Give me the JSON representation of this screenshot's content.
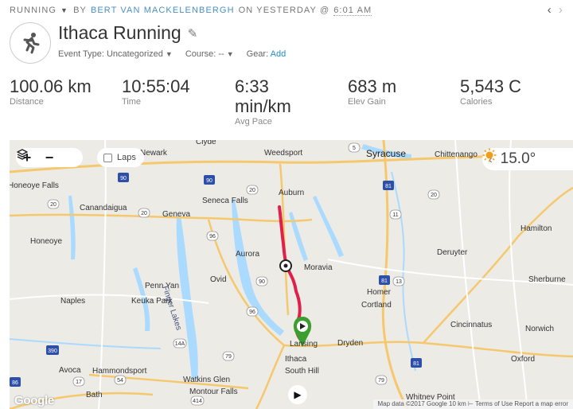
{
  "topbar": {
    "activity_type": "RUNNING",
    "by": "BY",
    "owner": "BERT VAN MACKELENBERGH",
    "when": "ON YESTERDAY @",
    "time": "6:01 AM",
    "prev_icon": "chevron-left-icon",
    "next_icon": "chevron-right-icon"
  },
  "header": {
    "activity_icon": "running-person-icon",
    "title": "Ithaca Running",
    "edit_icon": "pencil-icon",
    "event_type": "Event Type: Uncategorized",
    "course": "Course: --",
    "gear_label": "Gear:",
    "gear_add": "Add"
  },
  "stats": [
    {
      "value": "100.06 km",
      "label": "Distance"
    },
    {
      "value": "10:55:04",
      "label": "Time"
    },
    {
      "value": "6:33",
      "value2": "min/km",
      "label": "Avg Pace"
    },
    {
      "value": "683 m",
      "label": "Elev Gain"
    },
    {
      "value": "5,543 C",
      "label": "Calories"
    }
  ],
  "map": {
    "zoom_in": "+",
    "zoom_out": "−",
    "layers_icon": "layers-icon",
    "laps_label": "Laps",
    "weather_temp": "15.0°",
    "weather_icon": "sun-icon",
    "google": "Google",
    "attribution": "Map data ©2017 Google    10 km ⊢    Terms of Use    Report a map error",
    "labels": {
      "newark": "Newark",
      "clyde": "Clyde",
      "weedsport": "Weedsport",
      "syracuse": "Syracuse",
      "chittenango": "Chittenango",
      "honeoye_falls": "Honeoye Falls",
      "canandaigua": "Canandaigua",
      "geneva": "Geneva",
      "seneca_falls": "Seneca Falls",
      "auburn": "Auburn",
      "hamilton": "Hamilton",
      "honeoye": "Honeoye",
      "aurora": "Aurora",
      "moravia": "Moravia",
      "deruyter": "Deruyter",
      "penn_yan": "Penn Yan",
      "ovid": "Ovid",
      "homer": "Homer",
      "sherburne": "Sherburne",
      "naples": "Naples",
      "keuka_park": "Keuka Park",
      "cortland": "Cortland",
      "finger_lakes": "Finger Lakes",
      "cincinnatus": "Cincinnatus",
      "norwich": "Norwich",
      "lansing": "Lansing",
      "dryden": "Dryden",
      "ithaca": "Ithaca",
      "south_hill": "South Hill",
      "avoca": "Avoca",
      "hammondsport": "Hammondsport",
      "watkins_glen": "Watkins Glen",
      "oxford": "Oxford",
      "montour_falls": "Montour Falls",
      "bath": "Bath",
      "whitney_point": "Whitney Point"
    },
    "route_color": "#e0204a"
  }
}
